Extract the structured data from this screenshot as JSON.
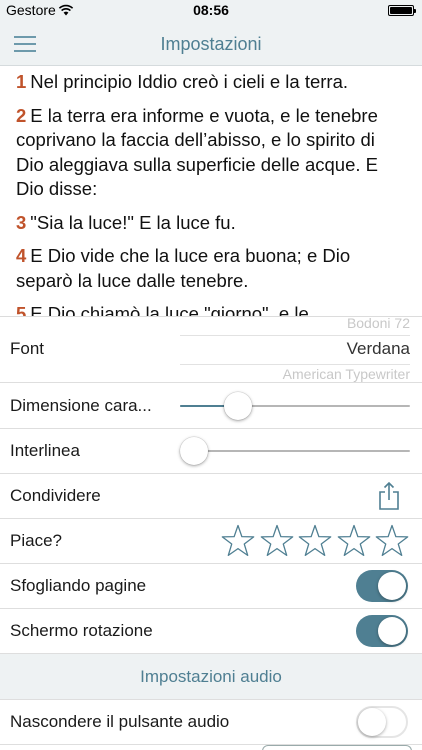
{
  "status_bar": {
    "carrier": "Gestore",
    "time": "08:56"
  },
  "nav": {
    "title": "Impostazioni"
  },
  "reader": {
    "verses": [
      {
        "num": "1",
        "text": "Nel principio Iddio creò i cieli e la terra."
      },
      {
        "num": "2",
        "text": "E la terra era informe e vuota, e le tenebre coprivano la faccia dell’abisso, e lo spirito di Dio aleggiava sulla superficie delle acque. E Dio disse:"
      },
      {
        "num": "3",
        "text": "\"Sia la luce!\" E la luce fu."
      },
      {
        "num": "4",
        "text": "E Dio vide che la luce era buona; e Dio separò la luce dalle tenebre."
      },
      {
        "num": "5",
        "text": "E Dio chiamò la luce \"giorno\", e le"
      }
    ]
  },
  "settings": {
    "font": {
      "label": "Font",
      "prev_option": "Bodoni 72",
      "selected": "Verdana",
      "next_option": "American Typewriter"
    },
    "font_size": {
      "label": "Dimensione cara...",
      "value": 0.25
    },
    "line_spacing": {
      "label": "Interlinea",
      "value": 0.06
    },
    "share": {
      "label": "Condividere",
      "icon": "share-icon"
    },
    "rate": {
      "label": "Piace?",
      "stars_total": 5,
      "stars_filled": 0
    },
    "page_flip": {
      "label": "Sfogliando pagine",
      "on": true
    },
    "rotation": {
      "label": "Schermo rotazione",
      "on": true
    },
    "audio_section": {
      "label": "Impostazioni audio"
    },
    "hide_audio": {
      "label": "Nascondere il pulsante audio",
      "on": false
    }
  },
  "colors": {
    "accent": "#4f7f92",
    "verse_number": "#c0532b",
    "bar_background": "#eef2f3"
  }
}
